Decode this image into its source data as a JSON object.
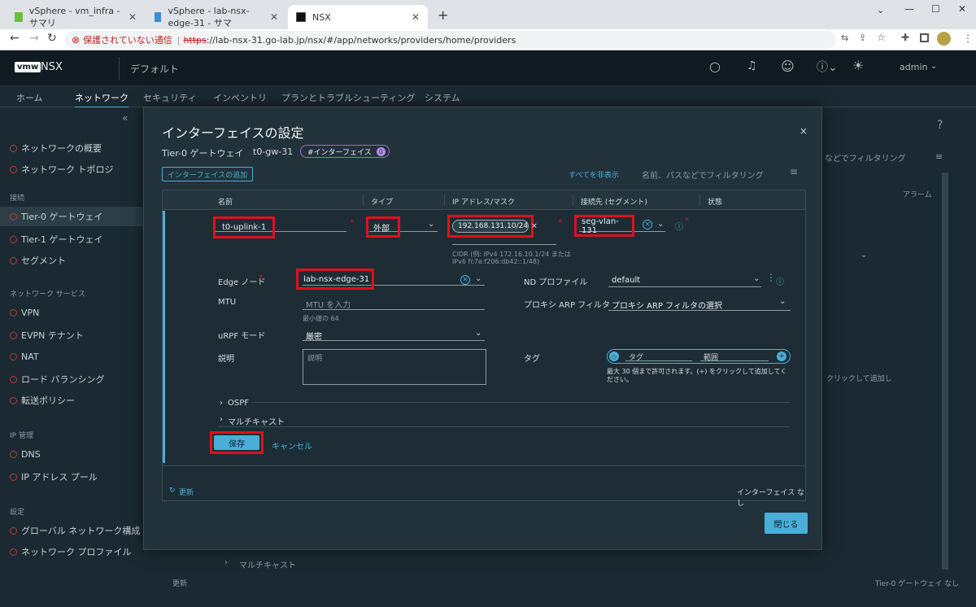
{
  "browser": {
    "tabs": [
      {
        "label": "vSphere - vm_infra - サマリ"
      },
      {
        "label": "vSphere - lab-nsx-edge-31 - サマ"
      },
      {
        "label": "NSX"
      }
    ],
    "new_tab": "+",
    "security_warning": "保護されていない通信",
    "url_scheme": "https",
    "url_rest": "://lab-nsx-31.go-lab.jp/nsx/#/app/networks/providers/home/providers"
  },
  "header": {
    "logo": "vmw",
    "product": "NSX",
    "context": "デフォルト",
    "user": "admin"
  },
  "nav": {
    "items": [
      "ホーム",
      "ネットワーク",
      "セキュリティ",
      "インベントリ",
      "プランとトラブルシューティング",
      "システム"
    ],
    "active": "ネットワーク"
  },
  "sidebar": {
    "items": [
      {
        "label": "ネットワークの概要"
      },
      {
        "label": "ネットワーク トポロジ"
      }
    ],
    "section_connect": "接続",
    "connect_items": [
      {
        "label": "Tier-0 ゲートウェイ"
      },
      {
        "label": "Tier-1 ゲートウェイ"
      },
      {
        "label": "セグメント"
      }
    ],
    "section_services": "ネットワーク サービス",
    "service_items": [
      {
        "label": "VPN"
      },
      {
        "label": "EVPN テナント"
      },
      {
        "label": "NAT"
      },
      {
        "label": "ロード バランシング"
      },
      {
        "label": "転送ポリシー"
      }
    ],
    "section_ip": "IP 管理",
    "ip_items": [
      {
        "label": "DNS"
      },
      {
        "label": "IP アドレス プール"
      }
    ],
    "section_settings": "設定",
    "settings_items": [
      {
        "label": "グローバル ネットワーク構成"
      },
      {
        "label": "ネットワーク プロファイル"
      }
    ]
  },
  "background": {
    "filter_placeholder": "などでフィルタリング",
    "alarm_col": "アラーム",
    "add_hint": "クリックして追加し",
    "multicast": "マルチキャスト",
    "refresh": "更新",
    "footer": "Tier-0 ゲートウェイ なし"
  },
  "modal": {
    "title": "インターフェイスの設定",
    "gateway_type": "Tier-0 ゲートウェイ",
    "gateway_name": "t0-gw-31",
    "interfaces_badge": "#インターフェイス",
    "interfaces_count": "0",
    "add_button": "インターフェイスの追加",
    "hide_all": "すべてを非表示",
    "filter_placeholder": "名前、パスなどでフィルタリング",
    "columns": [
      "名前",
      "タイプ",
      "IP アドレス/マスク",
      "接続先 (セグメント)",
      "状態"
    ],
    "row": {
      "name": "t0-uplink-1",
      "type": "外部",
      "ip": "192.168.131.10/24",
      "segment": "seg-vlan-131",
      "cidr_help_1": "CIDR (例: IPv4 172.16.10.1/24 または",
      "cidr_help_2": "IPv6 fc7e:f206:db42::1/48)"
    },
    "edge_node_label": "Edge ノード",
    "edge_node_value": "lab-nsx-edge-31",
    "mtu_label": "MTU",
    "mtu_placeholder": "MTU を入力",
    "mtu_min": "最小値の 64",
    "urpf_label": "uRPF モード",
    "urpf_value": "厳密",
    "desc_label": "説明",
    "desc_placeholder": "説明",
    "nd_profile_label": "ND プロファイル",
    "nd_profile_value": "default",
    "proxy_arp_label": "プロキシ ARP フィルタ",
    "proxy_arp_value": "プロキシ ARP フィルタの選択",
    "tag_label": "タグ",
    "tag_placeholder": "タグ",
    "scope_placeholder": "範囲",
    "tag_help": "最大 30 個まで許可されます。(+) をクリックして追加してください。",
    "ospf": "OSPF",
    "multicast": "マルチキャスト",
    "save": "保存",
    "cancel": "キャンセル",
    "refresh": "更新",
    "no_interfaces": "インターフェイス なし",
    "close_button": "閉じる"
  }
}
